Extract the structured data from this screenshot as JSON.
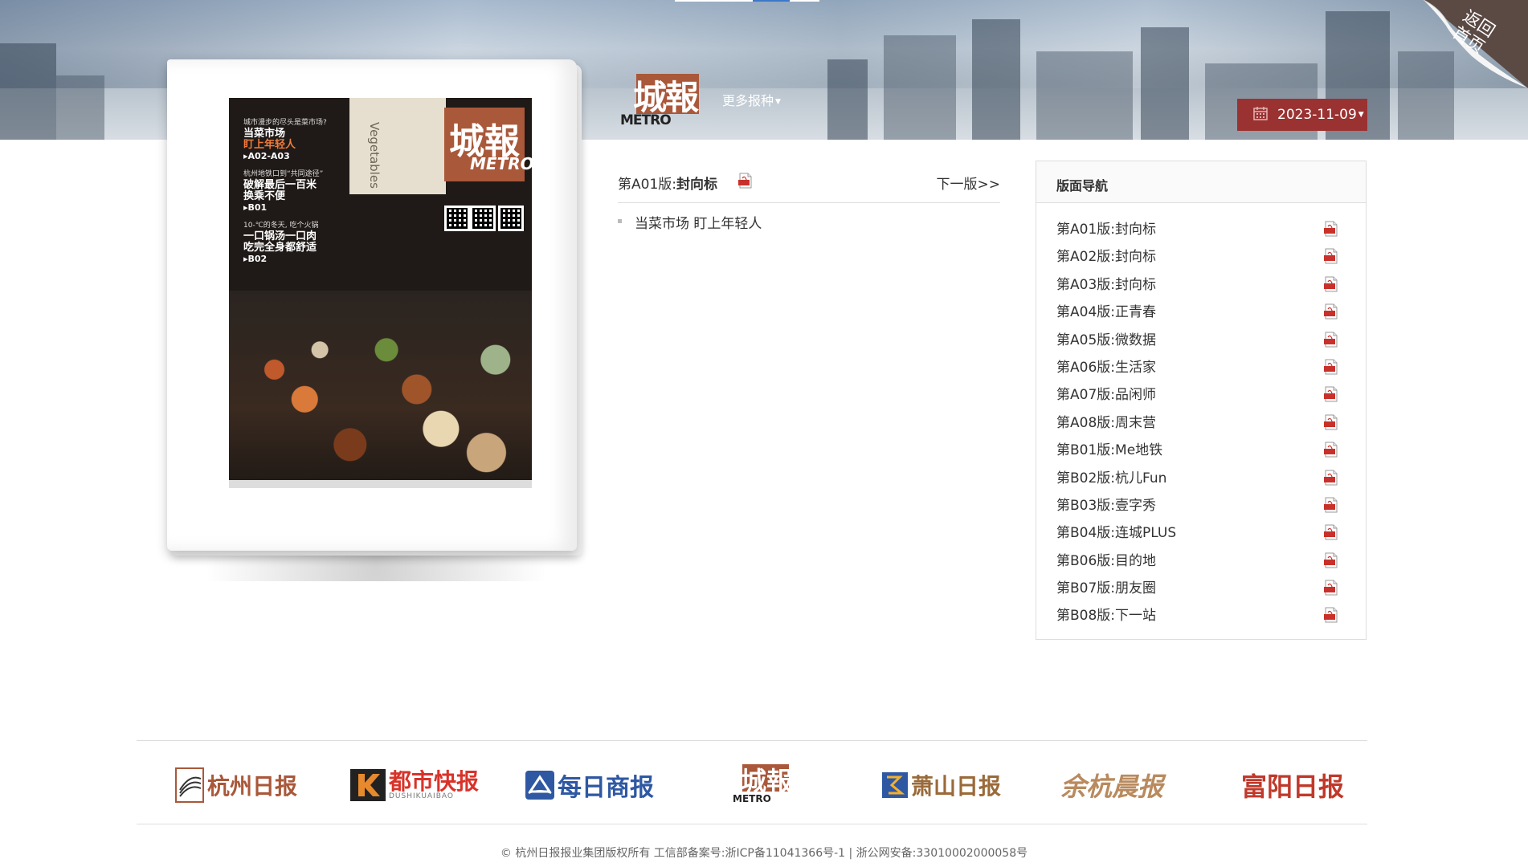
{
  "header": {
    "logo_cn": "城報",
    "logo_en": "METRO",
    "more_papers": "更多报种",
    "date": "2023-11-09",
    "back_home": "返回首页"
  },
  "cover": {
    "masthead": "城報",
    "masthead_en": "METRO",
    "sign_text": "Vegetables",
    "headlines": [
      {
        "small": "城市漫步的尽头是菜市场?",
        "big1": "当菜市场",
        "big2": "盯上年轻人",
        "ref": "▸A02-A03"
      },
      {
        "small": "杭州地铁口到“共同途径”",
        "big1": "破解最后一百米",
        "big2": "换乘不便",
        "ref": "▸B01"
      },
      {
        "small": "10-℃的冬天, 吃个火锅",
        "big1": "一口锅汤一口肉",
        "big2": "吃完全身都舒适",
        "ref": "▸B02"
      }
    ]
  },
  "edition": {
    "label_prefix": "第A01版:",
    "label_name": "封向标",
    "next": "下一版>>"
  },
  "articles": [
    "当菜市场 盯上年轻人"
  ],
  "nav": {
    "title": "版面导航",
    "items": [
      {
        "label": "第A01版:封向标"
      },
      {
        "label": "第A02版:封向标"
      },
      {
        "label": "第A03版:封向标"
      },
      {
        "label": "第A04版:正青春"
      },
      {
        "label": "第A05版:微数据"
      },
      {
        "label": "第A06版:生活家"
      },
      {
        "label": "第A07版:品闲师"
      },
      {
        "label": "第A08版:周末营"
      },
      {
        "label": "第B01版:Me地铁"
      },
      {
        "label": "第B02版:杭儿Fun"
      },
      {
        "label": "第B03版:壹字秀"
      },
      {
        "label": "第B04版:连城PLUS"
      },
      {
        "label": "第B06版:目的地"
      },
      {
        "label": "第B07版:朋友圈"
      },
      {
        "label": "第B08版:下一站"
      }
    ]
  },
  "partners": [
    {
      "name": "杭州日报"
    },
    {
      "name": "都市快报",
      "sub": "DUSHIKUAIBAO"
    },
    {
      "name": "每日商报"
    },
    {
      "name": "城報",
      "sub": "METRO"
    },
    {
      "name": "萧山日报"
    },
    {
      "name": "余杭晨报"
    },
    {
      "name": "富阳日报"
    }
  ],
  "footer": {
    "copyright": "© 杭州日报报业集团版权所有 工信部备案号:浙ICP备11041366号-1 | 浙公网安备:33010002000058号"
  },
  "colors": {
    "accent_red": "#9a3232",
    "logo_brown": "#a9583a",
    "pdf_red": "#c8312b"
  }
}
